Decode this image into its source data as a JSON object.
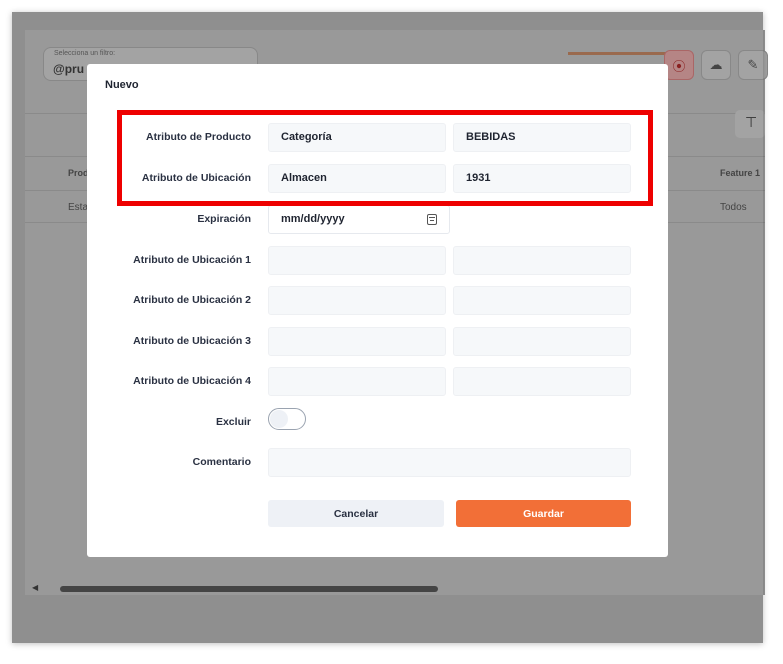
{
  "background": {
    "filter_label": "Selecciona un filtro:",
    "filter_value": "@pru",
    "table_header_left": "Prod",
    "table_cell_left": "Estat",
    "table_header_right": "Feature 1",
    "table_cell_right": "Todos"
  },
  "modal": {
    "title": "Nuevo",
    "rows": [
      {
        "label": "Atributo de Producto",
        "value1": "Categoría",
        "value2": "BEBIDAS"
      },
      {
        "label": "Atributo de Ubicación",
        "value1": "Almacen",
        "value2": "1931"
      }
    ],
    "expiration": {
      "label": "Expiración",
      "placeholder": "mm/dd/yyyy"
    },
    "location_attributes": [
      {
        "label": "Atributo de Ubicación 1",
        "value1": "",
        "value2": ""
      },
      {
        "label": "Atributo de Ubicación 2",
        "value1": "",
        "value2": ""
      },
      {
        "label": "Atributo de Ubicación 3",
        "value1": "",
        "value2": ""
      },
      {
        "label": "Atributo de Ubicación 4",
        "value1": "",
        "value2": ""
      }
    ],
    "exclude": {
      "label": "Excluir",
      "checked": false
    },
    "comment": {
      "label": "Comentario",
      "value": ""
    },
    "cancel_label": "Cancelar",
    "save_label": "Guardar"
  },
  "colors": {
    "accent": "#f26f37",
    "highlight": "#ee0000",
    "field_bg": "#f6f8fa"
  },
  "icons": [
    "calendar-icon",
    "record-icon",
    "cloud-download-icon",
    "pencil-icon",
    "filter-icon",
    "scroll-left-icon"
  ]
}
